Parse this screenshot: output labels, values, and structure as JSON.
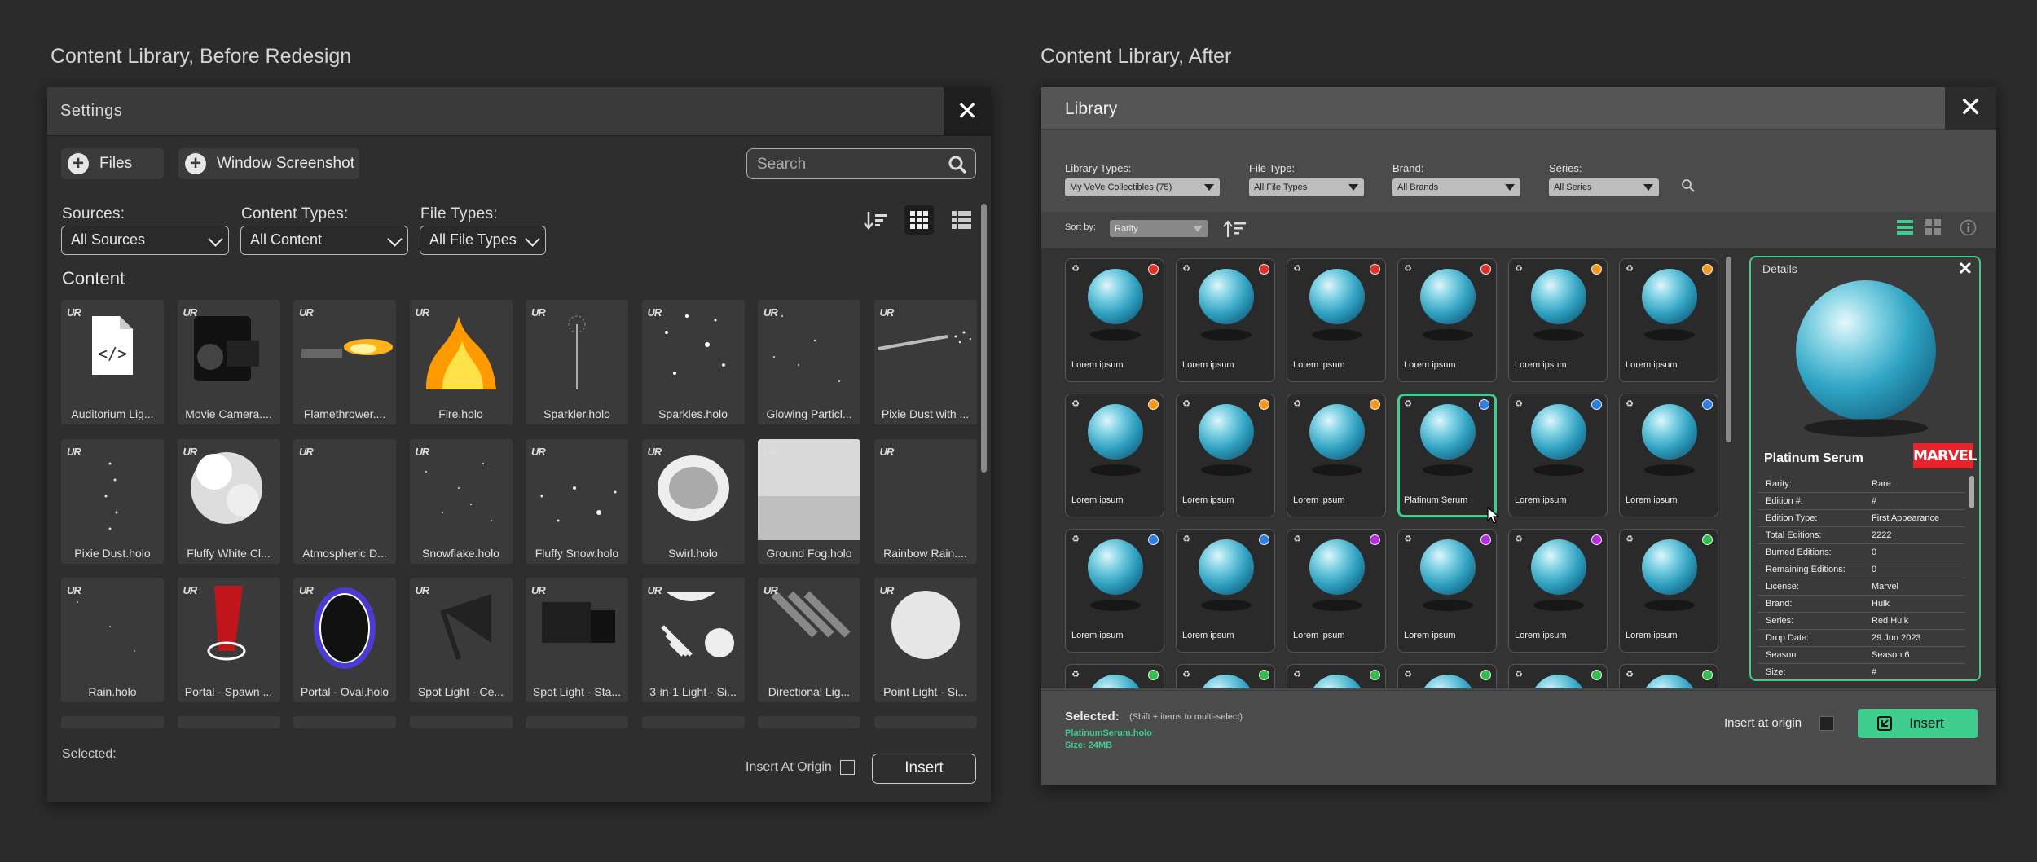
{
  "headings": {
    "before": "Content Library, Before Redesign",
    "after": "Content Library, After"
  },
  "before": {
    "title": "Settings",
    "close": "✕",
    "buttons": {
      "files": "Files",
      "window_screenshot": "Window Screenshot"
    },
    "search_placeholder": "Search",
    "filters": {
      "sources_label": "Sources:",
      "sources_value": "All Sources",
      "content_types_label": "Content Types:",
      "content_types_value": "All Content",
      "file_types_label": "File Types:",
      "file_types_value": "All File Types"
    },
    "section_title": "Content",
    "ur_badge": "UR",
    "items": [
      "Auditorium Lig...",
      "Movie Camera....",
      "Flamethrower....",
      "Fire.holo",
      "Sparkler.holo",
      "Sparkles.holo",
      "Glowing Particl...",
      "Pixie Dust with ...",
      "Pixie Dust.holo",
      "Fluffy White Cl...",
      "Atmospheric D...",
      "Snowflake.holo",
      "Fluffy Snow.holo",
      "Swirl.holo",
      "Ground Fog.holo",
      "Rainbow Rain....",
      "Rain.holo",
      "Portal - Spawn ...",
      "Portal - Oval.holo",
      "Spot Light - Ce...",
      "Spot Light - Sta...",
      "3-in-1 Light - Si...",
      "Directional Lig...",
      "Point Light - Si..."
    ],
    "selected_label": "Selected:",
    "insert_at_origin": "Insert At Origin",
    "insert": "Insert"
  },
  "after": {
    "title": "Library",
    "close": "✕",
    "filters": {
      "library_types_label": "Library Types:",
      "library_types_value": "My VeVe Collectibles  (75)",
      "file_type_label": "File Type:",
      "file_type_value": "All File Types",
      "brand_label": "Brand:",
      "brand_value": "All Brands",
      "series_label": "Series:",
      "series_value": "All Series"
    },
    "sort_label": "Sort by:",
    "sort_value": "Rarity",
    "cards": [
      {
        "label": "Lorem ipsum",
        "dot": "#e0302a"
      },
      {
        "label": "Lorem ipsum",
        "dot": "#e0302a"
      },
      {
        "label": "Lorem ipsum",
        "dot": "#e0302a"
      },
      {
        "label": "Lorem ipsum",
        "dot": "#e0302a"
      },
      {
        "label": "Lorem ipsum",
        "dot": "#f39a1c"
      },
      {
        "label": "Lorem ipsum",
        "dot": "#f39a1c"
      },
      {
        "label": "Lorem ipsum",
        "dot": "#f39a1c"
      },
      {
        "label": "Lorem ipsum",
        "dot": "#f39a1c"
      },
      {
        "label": "Lorem ipsum",
        "dot": "#f39a1c"
      },
      {
        "label": "Platinum Serum",
        "dot": "#2f7fe0"
      },
      {
        "label": "Lorem ipsum",
        "dot": "#2f7fe0"
      },
      {
        "label": "Lorem ipsum",
        "dot": "#2f7fe0"
      },
      {
        "label": "Lorem ipsum",
        "dot": "#2f7fe0"
      },
      {
        "label": "Lorem ipsum",
        "dot": "#2f7fe0"
      },
      {
        "label": "Lorem ipsum",
        "dot": "#b22fe0"
      },
      {
        "label": "Lorem ipsum",
        "dot": "#b22fe0"
      },
      {
        "label": "Lorem ipsum",
        "dot": "#b22fe0"
      },
      {
        "label": "Lorem ipsum",
        "dot": "#2fbf4a"
      },
      {
        "label": "",
        "dot": "#2fbf4a"
      },
      {
        "label": "",
        "dot": "#2fbf4a"
      },
      {
        "label": "",
        "dot": "#2fbf4a"
      },
      {
        "label": "",
        "dot": "#2fbf4a"
      },
      {
        "label": "",
        "dot": "#2fbf4a"
      },
      {
        "label": "",
        "dot": "#2fbf4a"
      }
    ],
    "details": {
      "title": "Details",
      "close": "✕",
      "name": "Platinum Serum",
      "brand_logo": "MARVEL",
      "rows": [
        {
          "k": "Rarity:",
          "v": "Rare"
        },
        {
          "k": "Edition #:",
          "v": "#"
        },
        {
          "k": "Edition Type:",
          "v": "First Appearance"
        },
        {
          "k": "Total Editions:",
          "v": "2222"
        },
        {
          "k": "Burned Editions:",
          "v": "0"
        },
        {
          "k": "Remaining Editions:",
          "v": "0"
        },
        {
          "k": "License:",
          "v": "Marvel"
        },
        {
          "k": "Brand:",
          "v": "Hulk"
        },
        {
          "k": "Series:",
          "v": "Red Hulk"
        },
        {
          "k": "Drop Date:",
          "v": "29 Jun 2023"
        },
        {
          "k": "Season:",
          "v": "Season 6"
        },
        {
          "k": "Size:",
          "v": "#"
        }
      ]
    },
    "footer": {
      "selected_label": "Selected:",
      "selected_hint": "(Shift + items to multi-select)",
      "file_name": "PlatinumSerum.holo",
      "size": "Size: 24MB",
      "insert_at_origin": "Insert at origin",
      "insert": "Insert"
    },
    "accent": "#3fcc8c"
  }
}
